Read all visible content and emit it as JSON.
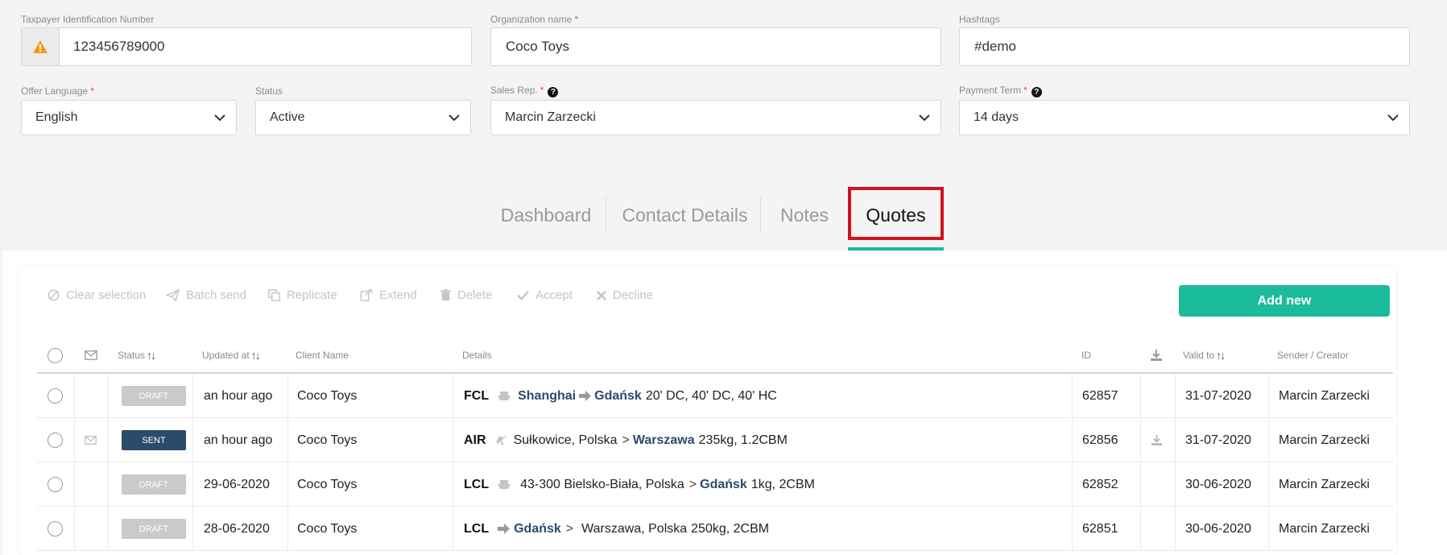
{
  "form": {
    "tax_id": {
      "label": "Taxpayer Identification Number",
      "value": "123456789000"
    },
    "org_name": {
      "label": "Organization name",
      "required_mark": "*",
      "value": "Coco Toys"
    },
    "hashtags": {
      "label": "Hashtags",
      "value": "#demo"
    },
    "offer_language": {
      "label": "Offer Language",
      "required_mark": "*",
      "value": "English"
    },
    "status": {
      "label": "Status",
      "value": "Active"
    },
    "sales_rep": {
      "label": "Sales Rep.",
      "required_mark": "*",
      "help": "?",
      "value": "Marcin Zarzecki"
    },
    "payment_term": {
      "label": "Payment Term",
      "required_mark": "*",
      "help": "?",
      "value": "14 days"
    }
  },
  "tabs": [
    {
      "label": "Dashboard",
      "active": false
    },
    {
      "label": "Contact Details",
      "active": false
    },
    {
      "label": "Notes",
      "active": false
    },
    {
      "label": "Quotes",
      "active": true
    }
  ],
  "toolbar": {
    "clear_selection": "Clear selection",
    "batch_send": "Batch send",
    "replicate": "Replicate",
    "extend": "Extend",
    "delete": "Delete",
    "accept": "Accept",
    "decline": "Decline",
    "add_new": "Add new"
  },
  "table": {
    "headers": {
      "status": "Status",
      "updated_at": "Updated at",
      "client_name": "Client Name",
      "details": "Details",
      "id": "ID",
      "valid_to": "Valid to",
      "sender": "Sender / Creator"
    },
    "sort_glyph": "↑↓",
    "rows": [
      {
        "status": "DRAFT",
        "updated": "an hour ago",
        "client": "Coco Toys",
        "mode": "FCL",
        "from": "Shanghai",
        "to": "Gdańsk",
        "spec": "20' DC, 40' DC, 40' HC",
        "id": "62857",
        "valid_to": "31-07-2020",
        "sender": "Marcin Zarzecki"
      },
      {
        "status": "SENT",
        "updated": "an hour ago",
        "client": "Coco Toys",
        "mode": "AIR",
        "from": "Sułkowice, Polska",
        "to": "Warszawa",
        "spec": "235kg, 1.2CBM",
        "id": "62856",
        "valid_to": "31-07-2020",
        "sender": "Marcin Zarzecki"
      },
      {
        "status": "DRAFT",
        "updated": "29-06-2020",
        "client": "Coco Toys",
        "mode": "LCL",
        "from": "43-300 Bielsko-Biała, Polska",
        "to": "Gdańsk",
        "spec": "1kg, 2CBM",
        "id": "62852",
        "valid_to": "30-06-2020",
        "sender": "Marcin Zarzecki"
      },
      {
        "status": "DRAFT",
        "updated": "28-06-2020",
        "client": "Coco Toys",
        "mode": "LCL",
        "from": "Gdańsk",
        "to": "Warszawa, Polska",
        "spec": "250kg, 2CBM",
        "id": "62851",
        "valid_to": "30-06-2020",
        "sender": "Marcin Zarzecki"
      }
    ],
    "gt": ">"
  },
  "colors": {
    "accent": "#1abc9c",
    "highlight": "#d4121c",
    "sent_badge": "#2c4a6b",
    "draft_badge": "#c9cacc"
  }
}
